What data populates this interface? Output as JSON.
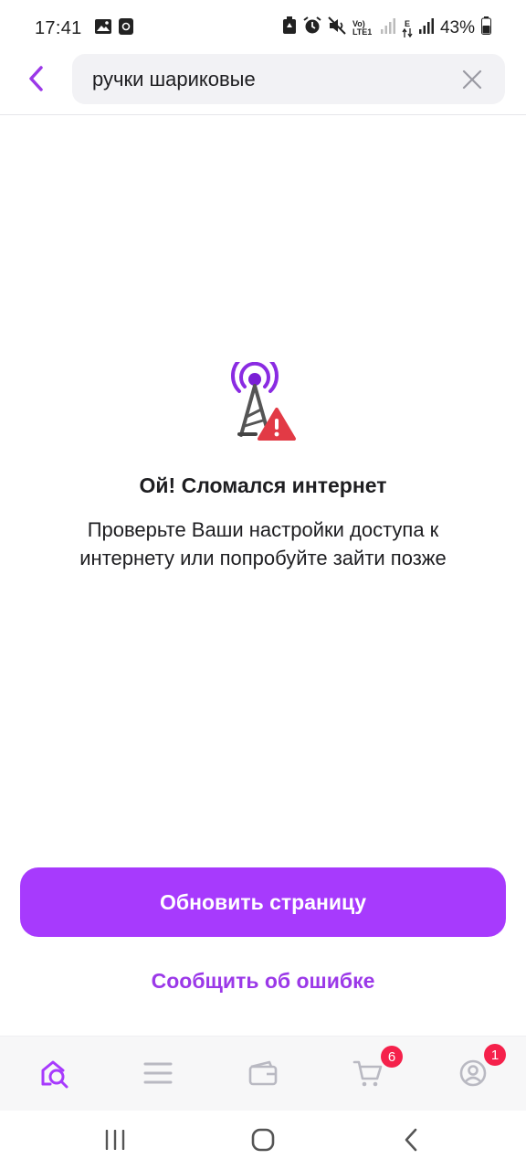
{
  "status_bar": {
    "time": "17:41",
    "battery_percent": "43%",
    "network_label": "Vo) LTE1",
    "data_label": "E",
    "icons": [
      "gallery-icon",
      "screen-record-icon",
      "battery-saver-icon",
      "alarm-icon",
      "mute-icon",
      "signal-icon",
      "data-arrows-icon",
      "signal-icon",
      "battery-icon"
    ]
  },
  "header": {
    "search_value": "ручки шариковые",
    "back_icon": "chevron-left-icon",
    "clear_icon": "close-icon"
  },
  "error": {
    "icon": "no-signal-tower-icon",
    "title": "Ой! Сломался интернет",
    "message": "Проверьте Ваши настройки доступа к интернету или попробуйте зайти позже"
  },
  "actions": {
    "refresh_label": "Обновить страницу",
    "report_label": "Сообщить об ошибке"
  },
  "bottom_nav": {
    "items": [
      {
        "icon": "home-search-icon",
        "active": true
      },
      {
        "icon": "catalog-menu-icon",
        "active": false
      },
      {
        "icon": "wallet-icon",
        "active": false
      },
      {
        "icon": "cart-icon",
        "badge": "6",
        "active": false
      },
      {
        "icon": "profile-icon",
        "badge": "1",
        "active": false
      }
    ]
  },
  "system_nav": {
    "icons": [
      "recent-apps-icon",
      "home-icon",
      "back-icon"
    ]
  },
  "colors": {
    "accent": "#a73afd",
    "accent_text": "#9b38e8",
    "badge": "#f5214b",
    "warning": "#e23a45"
  }
}
